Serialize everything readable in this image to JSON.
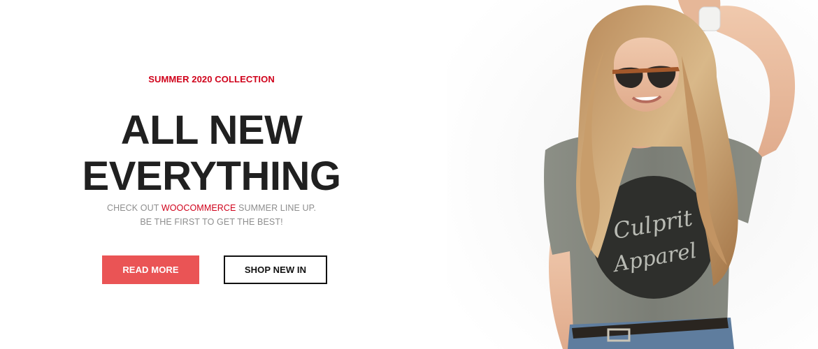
{
  "hero": {
    "eyebrow": "SUMMER 2020 COLLECTION",
    "headline_line1": "ALL NEW",
    "headline_line2": "EVERYTHING",
    "sub_prefix": "CHECK OUT ",
    "sub_highlight": "WOOCOMMERCE",
    "sub_suffix": " SUMMER LINE UP.",
    "sub_line2": "BE THE FIRST TO GET THE BEST!",
    "read_more_label": "READ MORE",
    "shop_label": "SHOP NEW IN"
  },
  "photo": {
    "shirt_text_1": "Culprit",
    "shirt_text_2": "Apparel"
  },
  "colors": {
    "accent_red": "#d0021b",
    "button_red": "#ea5455",
    "headline": "#202020",
    "muted": "#8e8e8e"
  }
}
